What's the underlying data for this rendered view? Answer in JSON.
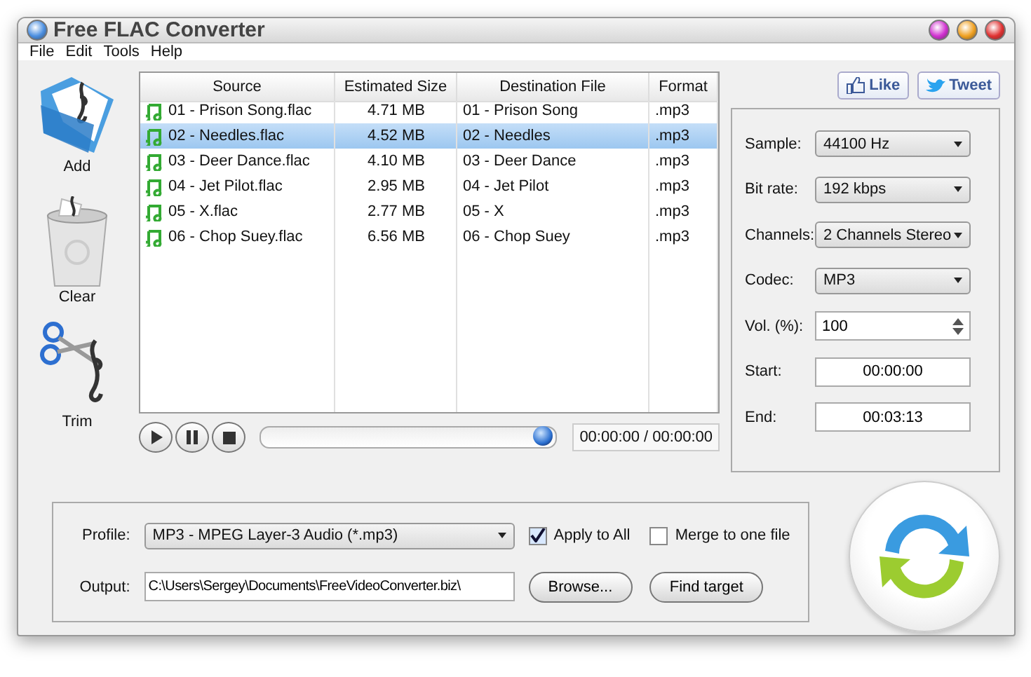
{
  "window": {
    "title": "Free FLAC Converter"
  },
  "menu": [
    "File",
    "Edit",
    "Tools",
    "Help"
  ],
  "tools": [
    {
      "kind": "add",
      "label": "Add"
    },
    {
      "kind": "clear",
      "label": "Clear"
    },
    {
      "kind": "trim",
      "label": "Trim"
    }
  ],
  "table": {
    "columns": [
      "Source",
      "Estimated Size",
      "Destination File",
      "Format"
    ],
    "rows": [
      {
        "source": "01 - Prison Song.flac",
        "size": "4.71 MB",
        "destination": "01 - Prison Song",
        "format": ".mp3",
        "selected": false
      },
      {
        "source": "02 - Needles.flac",
        "size": "4.52 MB",
        "destination": "02 - Needles",
        "format": ".mp3",
        "selected": true
      },
      {
        "source": "03 - Deer Dance.flac",
        "size": "4.10 MB",
        "destination": "03 - Deer Dance",
        "format": ".mp3",
        "selected": false
      },
      {
        "source": "04 - Jet Pilot.flac",
        "size": "2.95 MB",
        "destination": "04 - Jet Pilot",
        "format": ".mp3",
        "selected": false
      },
      {
        "source": "05 - X.flac",
        "size": "2.77 MB",
        "destination": "05 - X",
        "format": ".mp3",
        "selected": false
      },
      {
        "source": "06 - Chop Suey.flac",
        "size": "6.56 MB",
        "destination": "06 - Chop Suey",
        "format": ".mp3",
        "selected": false
      }
    ]
  },
  "player": {
    "buttons": [
      {
        "kind": "play"
      },
      {
        "kind": "pause"
      },
      {
        "kind": "stop"
      }
    ],
    "seek": {
      "level": 1
    },
    "time": "00:00:00 / 00:00:00"
  },
  "social": [
    {
      "kind": "like",
      "label": "Like"
    },
    {
      "kind": "tweet",
      "label": "Tweet"
    }
  ],
  "settings": [
    {
      "kind": "select",
      "label": "Sample:",
      "value": "44100 Hz"
    },
    {
      "kind": "select",
      "label": "Bit rate:",
      "value": "192 kbps"
    },
    {
      "kind": "select",
      "label": "Channels:",
      "value": "2 Channels Stereo"
    },
    {
      "kind": "select",
      "label": "Codec:",
      "value": "MP3"
    },
    {
      "kind": "spin",
      "label": "Vol. (%):",
      "value": "100"
    },
    {
      "kind": "time",
      "label": "Start:",
      "value": "00:00:00"
    },
    {
      "kind": "time",
      "label": "End:",
      "value": "00:03:13"
    }
  ],
  "profile": {
    "label": "Profile:",
    "value": "MP3 - MPEG Layer-3 Audio (*.mp3)"
  },
  "output": {
    "label": "Output:",
    "value": "C:\\Users\\Sergey\\Documents\\FreeVideoConverter.biz\\"
  },
  "options": [
    {
      "label": "Apply to All",
      "checked": true
    },
    {
      "label": "Merge to one file",
      "checked": false
    }
  ],
  "buttons": [
    "Browse...",
    "Find target"
  ]
}
